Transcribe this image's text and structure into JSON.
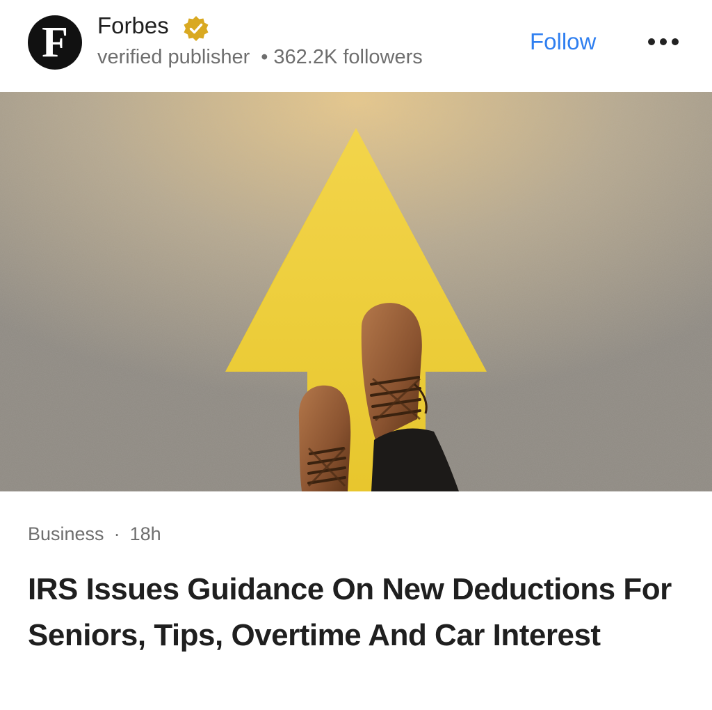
{
  "publisher": {
    "avatar_letter": "F",
    "name": "Forbes",
    "status": "verified publisher",
    "followers": "362.2K followers",
    "verified_icon": "verified-badge-icon",
    "badge_color": "#d9a921"
  },
  "actions": {
    "follow_label": "Follow",
    "follow_color": "#2f7ff0",
    "more_icon": "more-options-icon"
  },
  "article": {
    "category": "Business",
    "age": "18h",
    "headline": "IRS Issues Guidance On New Deductions For Seniors, Tips, Overtime And Car Interest"
  }
}
